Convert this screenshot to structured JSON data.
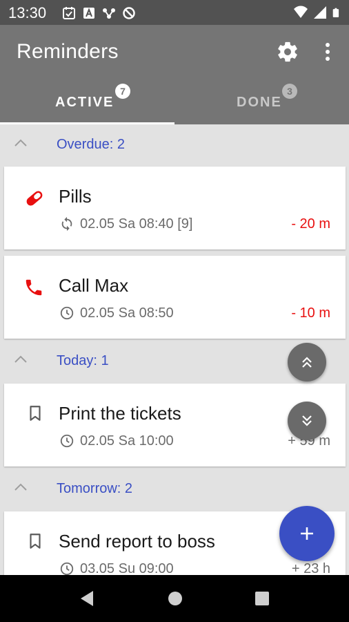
{
  "status_bar": {
    "time": "13:30",
    "left_icons": [
      "calendar-icon",
      "a-box-icon",
      "network-icon",
      "sync-off-icon"
    ],
    "right_icons": [
      "wifi-icon",
      "signal-icon",
      "battery-icon"
    ]
  },
  "app_bar": {
    "title": "Reminders",
    "actions": [
      "settings-icon",
      "more-vert-icon"
    ]
  },
  "tabs": [
    {
      "label": "ACTIVE",
      "badge": "7",
      "selected": true
    },
    {
      "label": "DONE",
      "badge": "3",
      "selected": false
    }
  ],
  "sections": [
    {
      "label": "Overdue: 2",
      "items": [
        {
          "icon": "pill-icon",
          "title": "Pills",
          "meta_icon": "repeat-icon",
          "meta": "02.05 Sa 08:40 [9]",
          "delta": "- 20 m",
          "delta_color": "#e81010"
        },
        {
          "icon": "phone-icon",
          "title": "Call Max",
          "meta_icon": "clock-icon",
          "meta": "02.05 Sa 08:50",
          "delta": "- 10 m",
          "delta_color": "#e81010"
        }
      ]
    },
    {
      "label": "Today: 1",
      "items": [
        {
          "icon": "bookmark-icon",
          "title": "Print the tickets",
          "meta_icon": "clock-icon",
          "meta": "02.05 Sa 10:00",
          "delta": "+ 59 m",
          "delta_color": "#6b6b6b"
        }
      ]
    },
    {
      "label": "Tomorrow: 2",
      "items": [
        {
          "icon": "bookmark-icon",
          "title": "Send report to boss",
          "meta_icon": "clock-icon",
          "meta": "03.05 Su 09:00",
          "delta": "+ 23 h",
          "delta_color": "#6b6b6b"
        }
      ]
    }
  ],
  "fabs": [
    "scroll-up-icon",
    "scroll-down-icon",
    "add-icon"
  ],
  "colors": {
    "accent": "#3a4fc4",
    "app_bar": "#757575",
    "overdue": "#e81010",
    "background": "#e2e2e2"
  }
}
